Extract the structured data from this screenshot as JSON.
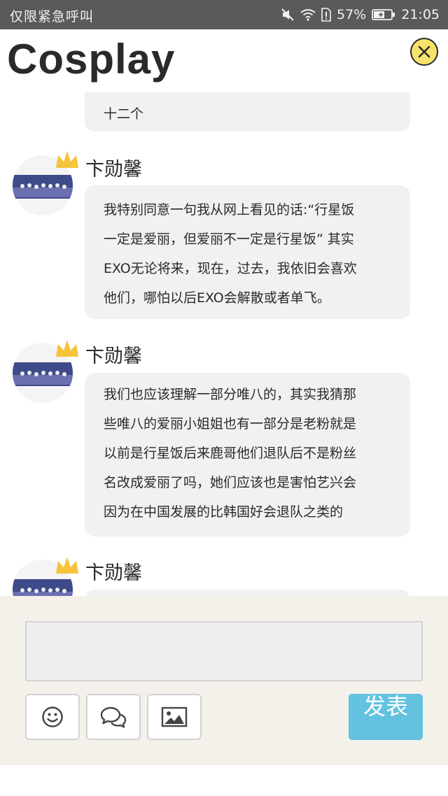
{
  "status_bar": {
    "carrier": "仅限紧急呼叫",
    "battery": "57%",
    "time": "21:05",
    "icons": [
      "mute-icon",
      "wifi-icon",
      "sim-icon",
      "battery-icon"
    ]
  },
  "header": {
    "title": "Cosplay",
    "close_icon": "close-icon"
  },
  "messages": [
    {
      "author": "",
      "lines": [
        "十二个"
      ]
    },
    {
      "author": "卞勋馨",
      "lines": [
        "我特别同意一句我从网上看见的话:“行星饭",
        "一定是爱丽，但爱丽不一定是行星饭” 其实",
        "EXO无论将来，现在，过去，我依旧会喜欢",
        "他们，哪怕以后EXO会解散或者单飞。"
      ]
    },
    {
      "author": "卞勋馨",
      "lines": [
        "我们也应该理解一部分唯八的，其实我猜那",
        "些唯八的爱丽小姐姐也有一部分是老粉就是",
        "以前是行星饭后来鹿哥他们退队后不是粉丝",
        "名改成爱丽了吗，她们应该也是害怕艺兴会",
        "因为在中国发展的比韩国好会退队之类的"
      ]
    },
    {
      "author": "卞勋馨",
      "lines": []
    }
  ],
  "compose": {
    "input_value": "",
    "emoji_icon": "smiley-icon",
    "chat_icon": "chat-bubbles-icon",
    "image_icon": "image-icon",
    "send_label": "发表"
  },
  "colors": {
    "status_bar": "#5a5a5a",
    "bubble": "#f1f1f1",
    "compose_bg": "#f3f1ea",
    "send_button": "#62c2e0",
    "close_button": "#f7e36b",
    "crown": "#f6c33a"
  }
}
